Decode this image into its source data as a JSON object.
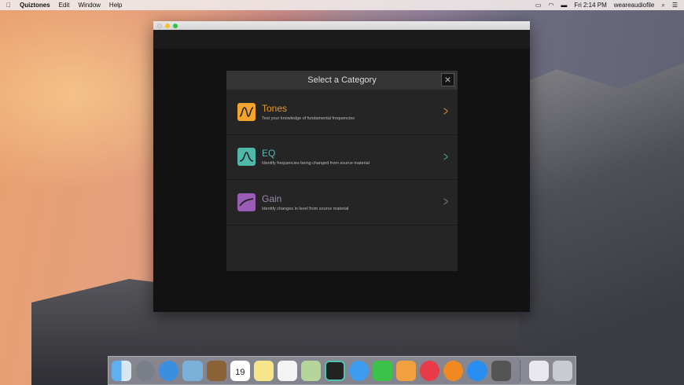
{
  "menubar": {
    "apple_icon": "apple-icon",
    "app": "Quiztones",
    "items": [
      "Edit",
      "Window",
      "Help"
    ],
    "clock": "Fri 2:14 PM",
    "user": "weareaudiofile"
  },
  "modal": {
    "title": "Select a Category",
    "categories": [
      {
        "title": "Tones",
        "description": "Test your knowledge of fundamental frequencies",
        "color": "#f5a32c",
        "text_color": "#e8962f"
      },
      {
        "title": "EQ",
        "description": "Identify frequencies being changed from source material",
        "color": "#4fb8a8",
        "text_color": "#5fb3b3"
      },
      {
        "title": "Gain",
        "description": "Identify changes in level from source material",
        "color": "#9b5cb8",
        "text_color": "#9a8aa5"
      }
    ]
  },
  "dock": {
    "apps": [
      "finder",
      "launchpad",
      "safari",
      "mail",
      "contacts",
      "calendar",
      "notes",
      "reminders",
      "maps",
      "quiztones",
      "messages",
      "facetime",
      "pages",
      "itunes",
      "ibooks",
      "app-store",
      "system-preferences"
    ],
    "calendar_day": "19"
  }
}
